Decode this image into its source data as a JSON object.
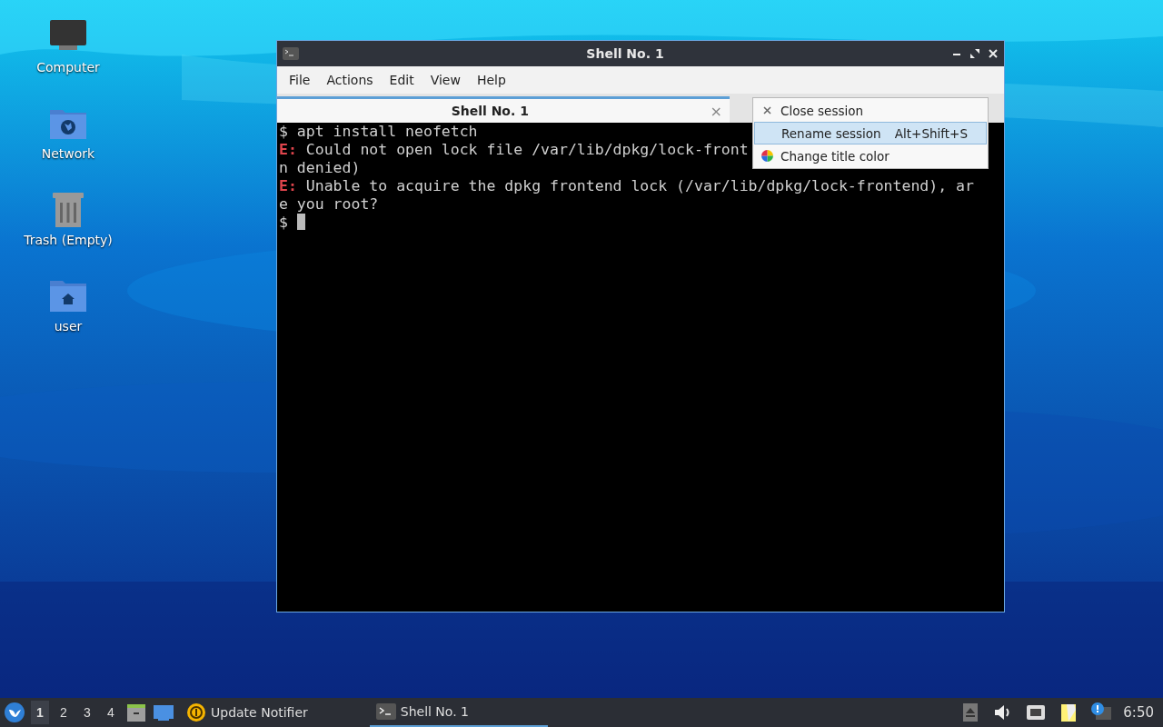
{
  "desktop_icons": [
    {
      "label": "Computer",
      "kind": "computer"
    },
    {
      "label": "Network",
      "kind": "network"
    },
    {
      "label": "Trash (Empty)",
      "kind": "trash"
    },
    {
      "label": "user",
      "kind": "home"
    }
  ],
  "window": {
    "title": "Shell No. 1",
    "menu_bar": [
      "File",
      "Actions",
      "Edit",
      "View",
      "Help"
    ],
    "tabs": [
      {
        "label": "Shell No. 1",
        "close": "×",
        "selected": true
      }
    ],
    "terminal_lines": [
      [
        {
          "text": "$ apt install neofetch",
          "kind": "plain"
        }
      ],
      [
        {
          "text": "E:",
          "kind": "error"
        },
        {
          "text": " Could not open lock file /var/lib/dpkg/lock-front",
          "kind": "plain"
        }
      ],
      [
        {
          "text": "n denied)",
          "kind": "plain"
        }
      ],
      [
        {
          "text": "E:",
          "kind": "error"
        },
        {
          "text": " Unable to acquire the dpkg frontend lock (/var/lib/dpkg/lock-frontend), ar",
          "kind": "plain"
        }
      ],
      [
        {
          "text": "e you root?",
          "kind": "plain"
        }
      ],
      [
        {
          "text": "$ ",
          "kind": "plain"
        },
        {
          "kind": "cursor"
        }
      ]
    ],
    "context_menu": [
      {
        "label": "Close session",
        "kind": "close",
        "selected": false
      },
      {
        "label": "Rename session",
        "shortcut": "Alt+Shift+S",
        "kind": "plain",
        "selected": true
      },
      {
        "label": "Change title color",
        "kind": "color",
        "selected": false
      }
    ]
  },
  "taskbar": {
    "workspaces": [
      {
        "label": "1",
        "selected": true
      },
      {
        "label": "2",
        "selected": false
      },
      {
        "label": "3",
        "selected": false
      },
      {
        "label": "4",
        "selected": false
      }
    ],
    "tasks": [
      {
        "label": "Update Notifier",
        "kind": "updater",
        "selected": false
      },
      {
        "label": "Shell No. 1",
        "kind": "terminal",
        "selected": true
      }
    ],
    "clock": "6:50"
  }
}
